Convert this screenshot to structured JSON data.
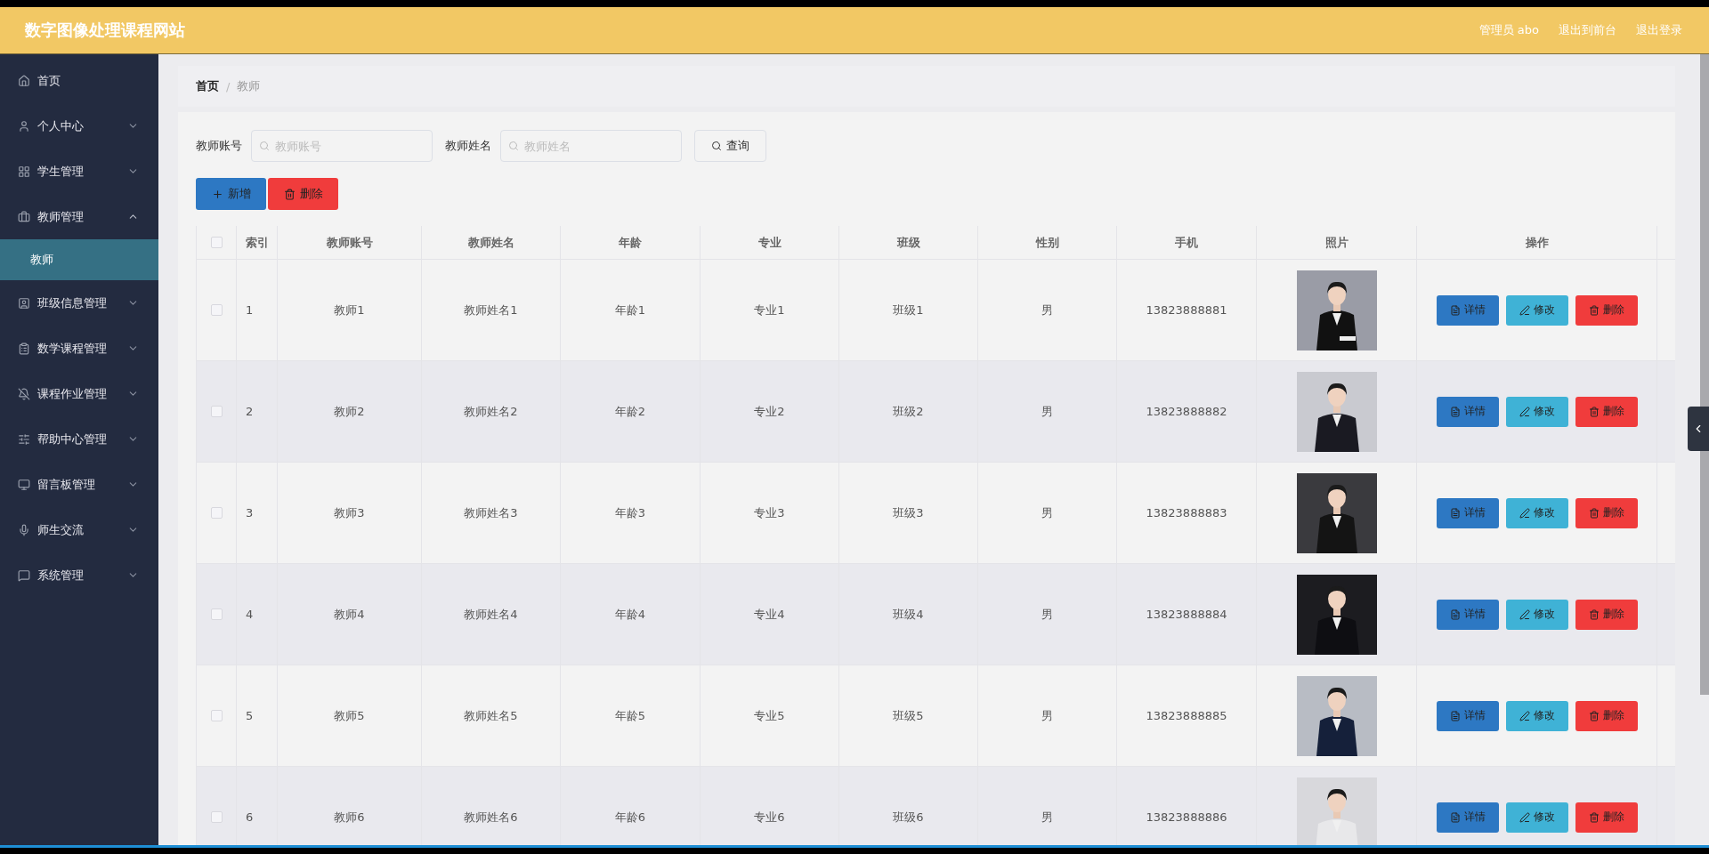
{
  "header": {
    "title": "数字图像处理课程网站",
    "links": [
      "管理员 abo",
      "退出到前台",
      "退出登录"
    ]
  },
  "sidebar": {
    "items": [
      {
        "label": "首页"
      },
      {
        "label": "个人中心",
        "expanded": false
      },
      {
        "label": "学生管理",
        "expanded": false
      },
      {
        "label": "教师管理",
        "expanded": true,
        "children": [
          {
            "label": "教师",
            "selected": true
          }
        ]
      },
      {
        "label": "班级信息管理",
        "expanded": false
      },
      {
        "label": "数学课程管理",
        "expanded": false
      },
      {
        "label": "课程作业管理",
        "expanded": false
      },
      {
        "label": "帮助中心管理",
        "expanded": false
      },
      {
        "label": "留言板管理",
        "expanded": false
      },
      {
        "label": "师生交流",
        "expanded": false
      },
      {
        "label": "系统管理",
        "expanded": false
      }
    ]
  },
  "breadcrumb": {
    "separator": "/",
    "items": [
      "首页",
      "教师"
    ]
  },
  "filters": [
    {
      "label": "教师账号",
      "placeholder": "教师账号"
    },
    {
      "label": "教师姓名",
      "placeholder": "教师姓名"
    }
  ],
  "search_button": "查询",
  "actions": [
    {
      "kind": "add",
      "label": "新增"
    },
    {
      "kind": "delete",
      "label": "删除"
    }
  ],
  "table": {
    "select_all": false,
    "columns": [
      "索引",
      "教师账号",
      "教师姓名",
      "年龄",
      "专业",
      "班级",
      "性别",
      "手机",
      "照片",
      "操作"
    ],
    "rows": [
      {
        "checked": false,
        "cells": [
          "1",
          "教师1",
          "教师姓名1",
          "年龄1",
          "专业1",
          "班级1",
          "男",
          "13823888881"
        ],
        "actions": [
          {
            "kind": "detail",
            "label": "详情"
          },
          {
            "kind": "edit",
            "label": "修改"
          },
          {
            "kind": "delete",
            "label": "删除"
          }
        ]
      },
      {
        "checked": false,
        "cells": [
          "2",
          "教师2",
          "教师姓名2",
          "年龄2",
          "专业2",
          "班级2",
          "男",
          "13823888882"
        ],
        "actions": [
          {
            "kind": "detail",
            "label": "详情"
          },
          {
            "kind": "edit",
            "label": "修改"
          },
          {
            "kind": "delete",
            "label": "删除"
          }
        ]
      },
      {
        "checked": false,
        "cells": [
          "3",
          "教师3",
          "教师姓名3",
          "年龄3",
          "专业3",
          "班级3",
          "男",
          "13823888883"
        ],
        "actions": [
          {
            "kind": "detail",
            "label": "详情"
          },
          {
            "kind": "edit",
            "label": "修改"
          },
          {
            "kind": "delete",
            "label": "删除"
          }
        ]
      },
      {
        "checked": false,
        "cells": [
          "4",
          "教师4",
          "教师姓名4",
          "年龄4",
          "专业4",
          "班级4",
          "男",
          "13823888884"
        ],
        "actions": [
          {
            "kind": "detail",
            "label": "详情"
          },
          {
            "kind": "edit",
            "label": "修改"
          },
          {
            "kind": "delete",
            "label": "删除"
          }
        ]
      },
      {
        "checked": false,
        "cells": [
          "5",
          "教师5",
          "教师姓名5",
          "年龄5",
          "专业5",
          "班级5",
          "男",
          "13823888885"
        ],
        "actions": [
          {
            "kind": "detail",
            "label": "详情"
          },
          {
            "kind": "edit",
            "label": "修改"
          },
          {
            "kind": "delete",
            "label": "删除"
          }
        ]
      },
      {
        "checked": false,
        "cells": [
          "6",
          "教师6",
          "教师姓名6",
          "年龄6",
          "专业6",
          "班级6",
          "男",
          "13823888886"
        ],
        "actions": [
          {
            "kind": "detail",
            "label": "详情"
          },
          {
            "kind": "edit",
            "label": "修改"
          },
          {
            "kind": "delete",
            "label": "删除"
          }
        ]
      }
    ]
  }
}
